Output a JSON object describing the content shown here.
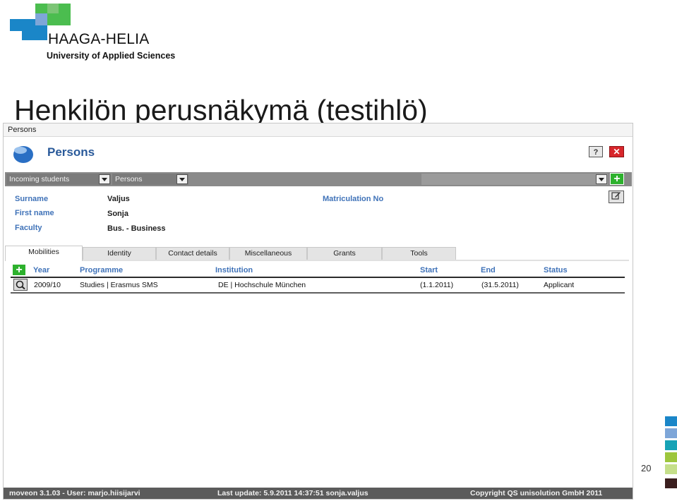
{
  "slide": {
    "logo_line1": "HAAGA-HELIA",
    "logo_line2": "University of Applied Sciences",
    "title": "Henkilön perusnäkymä (testihlö)",
    "page_number": "20"
  },
  "window": {
    "title": "Persons",
    "header_title": "Persons",
    "help_label": "?",
    "close_label": "✕"
  },
  "toolbar": {
    "dropdown1": "Incoming students",
    "dropdown2": "Persons",
    "dropdown3": "",
    "add_label": "+"
  },
  "person": {
    "surname_label": "Surname",
    "surname": "Valjus",
    "firstname_label": "First name",
    "firstname": "Sonja",
    "faculty_label": "Faculty",
    "faculty": "Bus. - Business",
    "matriculation_label": "Matriculation No",
    "matriculation": ""
  },
  "tabs": [
    "Mobilities",
    "Identity",
    "Contact details",
    "Miscellaneous",
    "Grants",
    "Tools"
  ],
  "mobilities": {
    "columns": [
      "Year",
      "Programme",
      "Institution",
      "Start",
      "End",
      "Status"
    ],
    "rows": [
      {
        "year": "2009/10",
        "programme": "Studies | Erasmus SMS",
        "institution": "DE | Hochschule München",
        "start": "(1.1.2011)",
        "end": "(31.5.2011)",
        "status": "Applicant"
      }
    ]
  },
  "statusbar": {
    "left": "moveon 3.1.03 - User: marjo.hiisijarvi",
    "middle": "Last update: 5.9.2011 14:37:51 sonja.valjus",
    "right": "Copyright QS unisolution GmbH 2011"
  },
  "colors": {
    "brand_blue": "#1a86c8",
    "brand_green": "#4bbd4f",
    "label_blue": "#3f72b8",
    "add_green": "#2db12d",
    "close_red": "#d8262b"
  }
}
